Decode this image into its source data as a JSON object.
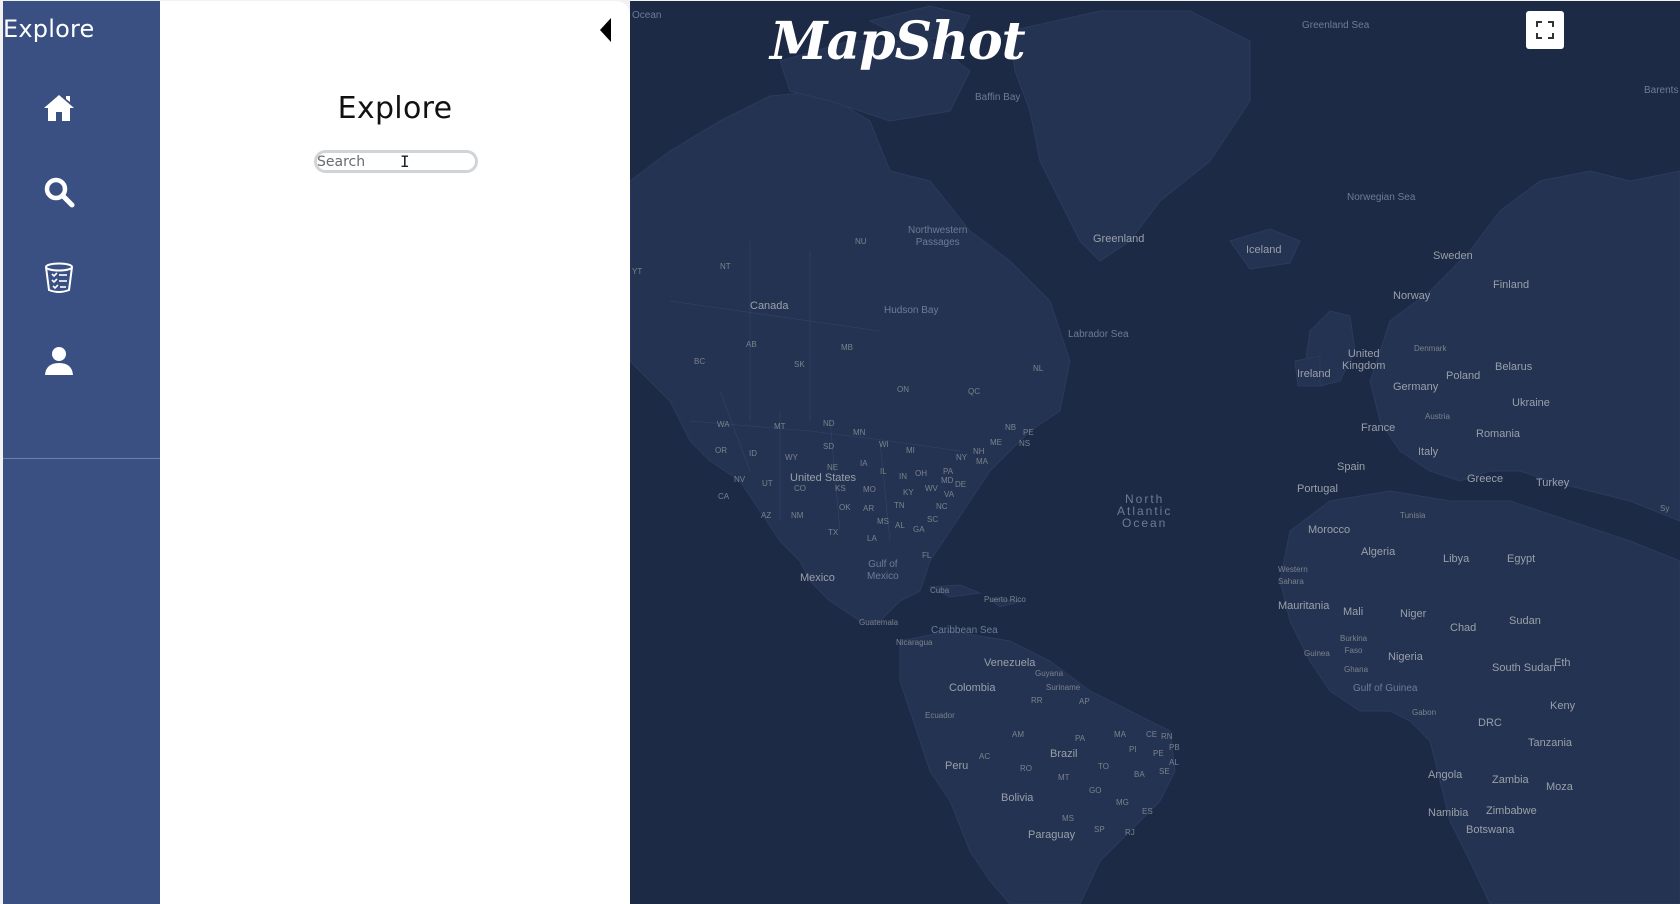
{
  "sidebar": {
    "title": "Explore",
    "items": [
      {
        "icon": "home-icon"
      },
      {
        "icon": "search-icon"
      },
      {
        "icon": "list-bucket-icon"
      },
      {
        "icon": "user-icon"
      }
    ],
    "color": "#3a5083"
  },
  "panel": {
    "title": "Explore",
    "search": {
      "placeholder": "Search",
      "value": ""
    },
    "collapse_icon": "caret-left-icon"
  },
  "map": {
    "logo": "MapShot",
    "fullscreen_icon": "fullscreen-icon",
    "background": "#1c2a46",
    "labels": {
      "ocean_top": "Ocean",
      "greenland_sea": "Greenland Sea",
      "baffin_bay": "Baffin Bay",
      "barents": "Barents S",
      "norwegian_sea": "Norwegian Sea",
      "nu": "NU",
      "northwestern_passages": "Northwestern\nPassages",
      "greenland": "Greenland",
      "iceland": "Iceland",
      "sweden": "Sweden",
      "finland": "Finland",
      "norway": "Norway",
      "yt": "YT",
      "nt": "NT",
      "canada": "Canada",
      "hudson_bay": "Hudson Bay",
      "labrador_sea": "Labrador Sea",
      "ab": "AB",
      "mb": "MB",
      "bc": "BC",
      "sk": "SK",
      "on": "ON",
      "qc": "QC",
      "nl": "NL",
      "united_kingdom": "United\nKingdom",
      "denmark": "Denmark",
      "ireland": "Ireland",
      "belarus": "Belarus",
      "poland": "Poland",
      "germany": "Germany",
      "ukraine": "Ukraine",
      "austria": "Austria",
      "france": "France",
      "romania": "Romania",
      "italy": "Italy",
      "spain": "Spain",
      "portugal": "Portugal",
      "greece": "Greece",
      "turkey": "Turkey",
      "sy": "Sy",
      "tunisia": "Tunisia",
      "morocco": "Morocco",
      "algeria": "Algeria",
      "libya": "Libya",
      "egypt": "Egypt",
      "western_sahara": "Western\nSahara",
      "mauritania": "Mauritania",
      "mali": "Mali",
      "niger": "Niger",
      "chad": "Chad",
      "sudan": "Sudan",
      "burkina_faso": "Burkina\nFaso",
      "guinea": "Guinea",
      "ghana": "Ghana",
      "nigeria": "Nigeria",
      "south_sudan": "South Sudan",
      "eth": "Eth",
      "gulf_of_guinea": "Gulf of Guinea",
      "gabon": "Gabon",
      "drc": "DRC",
      "keny": "Keny",
      "tanzania": "Tanzania",
      "angola": "Angola",
      "zambia": "Zambia",
      "moza": "Moza",
      "namibia": "Namibia",
      "zimbabwe": "Zimbabwe",
      "botswana": "Botswana",
      "north_atlantic_ocean": "North\nAtlantic\nOcean",
      "wa": "WA",
      "mt": "MT",
      "nd": "ND",
      "mn": "MN",
      "nb": "NB",
      "pe": "PE",
      "ns": "NS",
      "me": "ME",
      "or": "OR",
      "id": "ID",
      "wy": "WY",
      "sd": "SD",
      "wi": "WI",
      "mi": "MI",
      "ny": "NY",
      "nh": "NH",
      "ma": "MA",
      "nv": "NV",
      "ut": "UT",
      "united_states": "United States",
      "ne": "NE",
      "ia": "IA",
      "il": "IL",
      "in": "IN",
      "oh": "OH",
      "pa": "PA",
      "md": "MD",
      "de": "DE",
      "ca": "CA",
      "co": "CO",
      "ks": "KS",
      "mo": "MO",
      "ky": "KY",
      "wv": "WV",
      "va": "VA",
      "az": "AZ",
      "nm": "NM",
      "ok": "OK",
      "ar": "AR",
      "tn": "TN",
      "nc": "NC",
      "ms": "MS",
      "al": "AL",
      "ga": "GA",
      "sc": "SC",
      "tx": "TX",
      "la": "LA",
      "fl": "FL",
      "mexico": "Mexico",
      "gulf_of_mexico": "Gulf of\nMexico",
      "cuba": "Cuba",
      "puerto_rico": "Puerto Rico",
      "guatemala": "Guatemala",
      "caribbean_sea": "Caribbean Sea",
      "nicaragua": "Nicaragua",
      "venezuela": "Venezuela",
      "guyana": "Guyana",
      "suriname": "Suriname",
      "colombia": "Colombia",
      "rr": "RR",
      "ap": "AP",
      "ecuador": "Ecuador",
      "am": "AM",
      "pa_br": "PA",
      "ma_br": "MA",
      "ce": "CE",
      "rn": "RN",
      "pb": "PB",
      "pi": "PI",
      "pe_br": "PE",
      "al_br": "AL",
      "se": "SE",
      "brazil": "Brazil",
      "peru": "Peru",
      "ac": "AC",
      "ro": "RO",
      "to": "TO",
      "ba": "BA",
      "mt_br": "MT",
      "go": "GO",
      "mg": "MG",
      "es": "ES",
      "bolivia": "Bolivia",
      "ms_br": "MS",
      "sp": "SP",
      "rj": "RJ",
      "paraguay": "Paraguay"
    }
  }
}
